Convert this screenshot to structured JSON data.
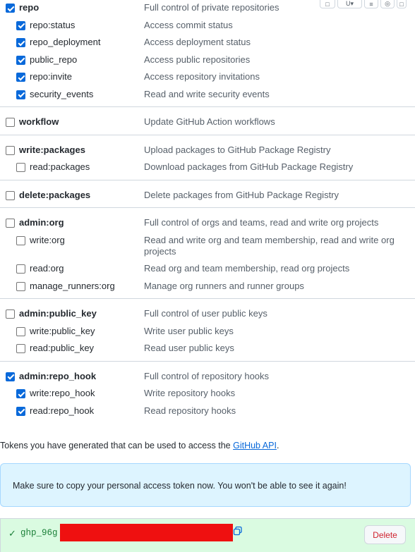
{
  "scopes": [
    {
      "name": "repo",
      "checked": true,
      "description": "Full control of private repositories",
      "children": [
        {
          "name": "repo:status",
          "checked": true,
          "description": "Access commit status"
        },
        {
          "name": "repo_deployment",
          "checked": true,
          "description": "Access deployment status"
        },
        {
          "name": "public_repo",
          "checked": true,
          "description": "Access public repositories"
        },
        {
          "name": "repo:invite",
          "checked": true,
          "description": "Access repository invitations"
        },
        {
          "name": "security_events",
          "checked": true,
          "description": "Read and write security events"
        }
      ]
    },
    {
      "name": "workflow",
      "checked": false,
      "description": "Update GitHub Action workflows",
      "children": []
    },
    {
      "name": "write:packages",
      "checked": false,
      "description": "Upload packages to GitHub Package Registry",
      "children": [
        {
          "name": "read:packages",
          "checked": false,
          "description": "Download packages from GitHub Package Registry"
        }
      ]
    },
    {
      "name": "delete:packages",
      "checked": false,
      "description": "Delete packages from GitHub Package Registry",
      "children": []
    },
    {
      "name": "admin:org",
      "checked": false,
      "description": "Full control of orgs and teams, read and write org projects",
      "children": [
        {
          "name": "write:org",
          "checked": false,
          "description": "Read and write org and team membership, read and write org projects"
        },
        {
          "name": "read:org",
          "checked": false,
          "description": "Read org and team membership, read org projects"
        },
        {
          "name": "manage_runners:org",
          "checked": false,
          "description": "Manage org runners and runner groups"
        }
      ]
    },
    {
      "name": "admin:public_key",
      "checked": false,
      "description": "Full control of user public keys",
      "children": [
        {
          "name": "write:public_key",
          "checked": false,
          "description": "Write user public keys"
        },
        {
          "name": "read:public_key",
          "checked": false,
          "description": "Read user public keys"
        }
      ]
    },
    {
      "name": "admin:repo_hook",
      "checked": true,
      "description": "Full control of repository hooks",
      "children": [
        {
          "name": "write:repo_hook",
          "checked": true,
          "description": "Write repository hooks"
        },
        {
          "name": "read:repo_hook",
          "checked": true,
          "description": "Read repository hooks"
        }
      ]
    }
  ],
  "api_note": {
    "prefix": "Tokens you have generated that can be used to access the ",
    "link": "GitHub API",
    "suffix": "."
  },
  "flash": {
    "message": "Make sure to copy your personal access token now. You won't be able to see it again!"
  },
  "token": {
    "value_visible": "ghp_96g",
    "delete_label": "Delete",
    "copy_icon": "copy-icon",
    "check_icon": "check-icon"
  },
  "colors": {
    "accent": "#0969da",
    "success_bg": "#dafbe1",
    "flash_bg": "#ddf4ff",
    "danger": "#cf222e",
    "redaction": "#ef1010"
  }
}
